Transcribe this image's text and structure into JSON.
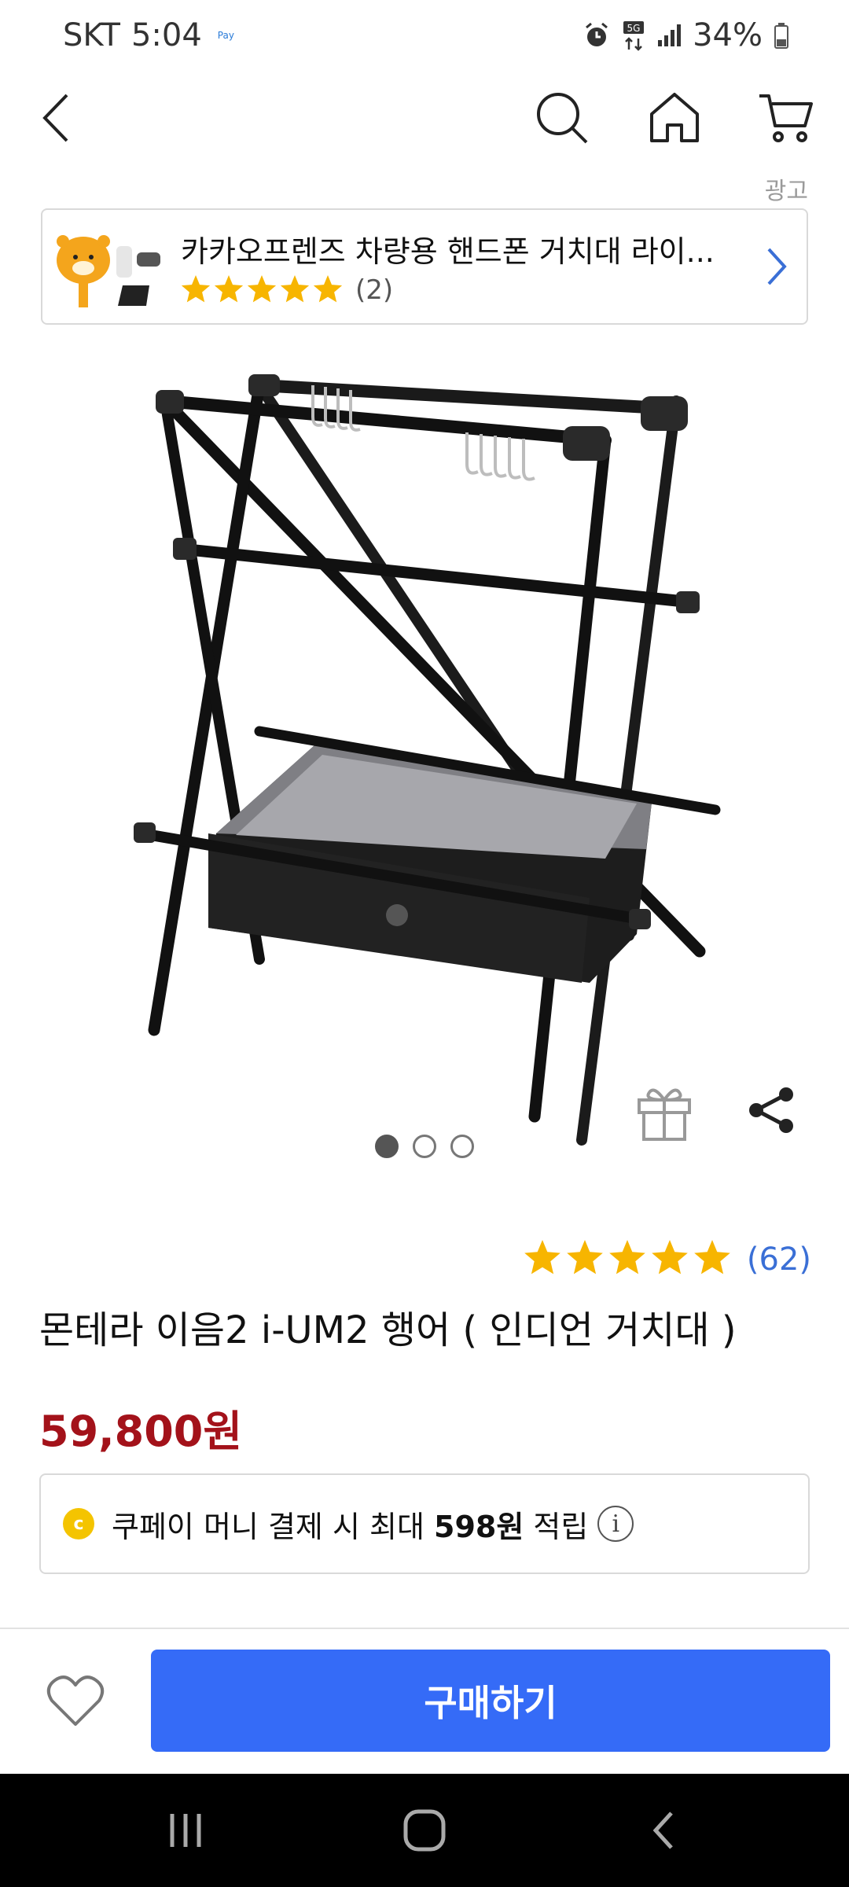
{
  "status_bar": {
    "carrier": "SKT",
    "time": "5:04",
    "pay_label": "Pay",
    "network": "5G",
    "battery": "34%"
  },
  "icons": {
    "back": "back-arrow-icon",
    "search": "search-icon",
    "home": "home-icon",
    "cart": "cart-icon",
    "gift": "gift-icon",
    "share": "share-icon",
    "heart": "heart-icon",
    "info": "info-icon"
  },
  "ad": {
    "label": "광고",
    "title": "카카오프렌즈 차량용 핸드폰 거치대 라이...",
    "rating_count": "(2)",
    "stars": 5
  },
  "gallery": {
    "total": 3,
    "active_index": 0
  },
  "product": {
    "rating_count": "(62)",
    "stars": 5,
    "title": "몬테라 이음2 i-UM2 행어 ( 인디언 거치대 )",
    "price": "59,800원"
  },
  "reward": {
    "coin_letter": "c",
    "prefix": "쿠페이 머니 결제 시 최대 ",
    "amount": "598원",
    "suffix": " 적립",
    "info_glyph": "i"
  },
  "actions": {
    "buy_label": "구매하기"
  },
  "colors": {
    "accent_blue": "#356bf7",
    "price_red": "#a3121a",
    "star_yellow": "#f7b500",
    "link_blue": "#3a6fd6"
  }
}
